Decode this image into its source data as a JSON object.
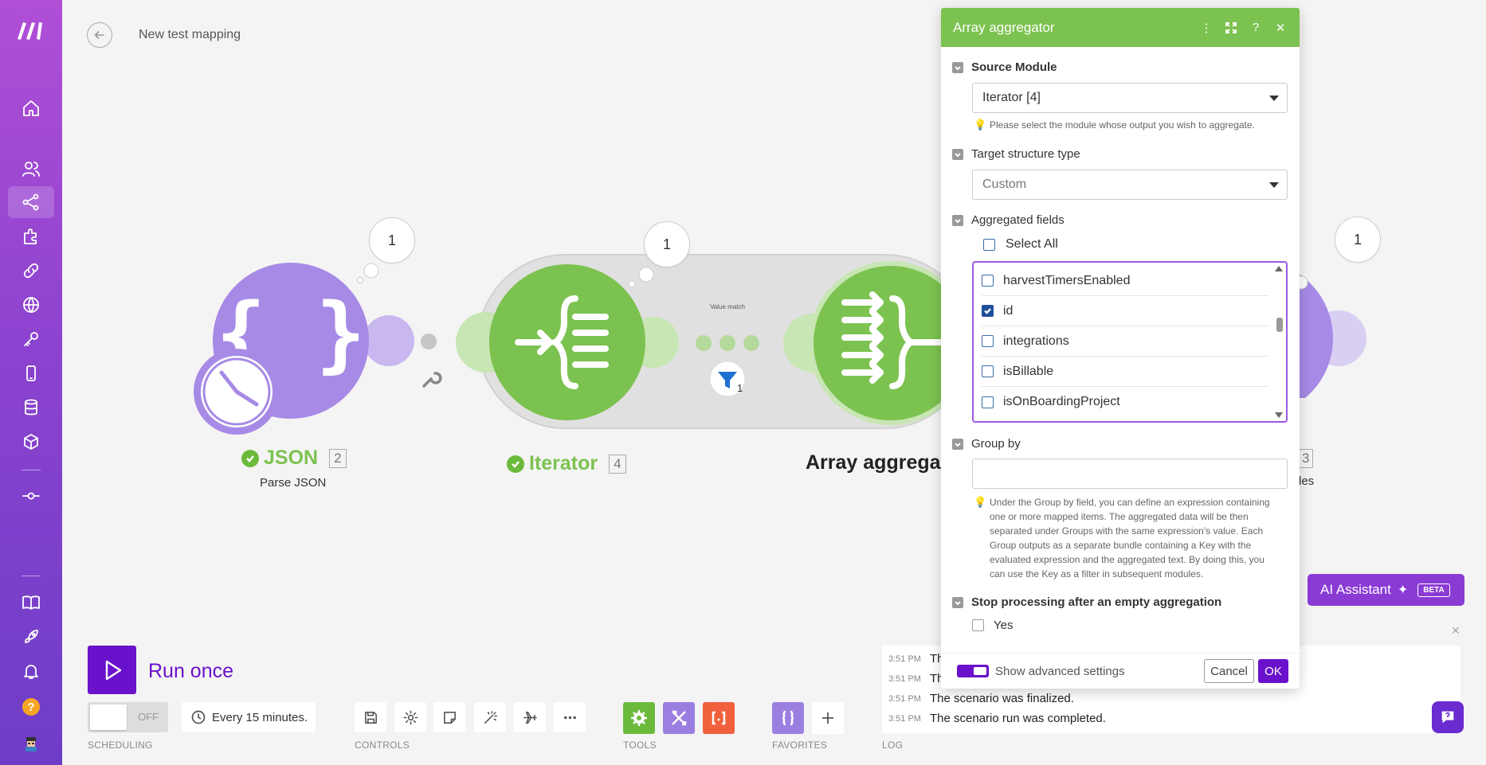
{
  "header": {
    "title": "New test mapping"
  },
  "sidebar": {
    "items": [
      {
        "name": "home"
      },
      {
        "name": "team"
      },
      {
        "name": "scenarios"
      },
      {
        "name": "templates"
      },
      {
        "name": "connections"
      },
      {
        "name": "webhooks"
      },
      {
        "name": "keys"
      },
      {
        "name": "devices"
      },
      {
        "name": "data-stores"
      },
      {
        "name": "data-structures"
      },
      {
        "name": "flow-control"
      },
      {
        "name": "help-docs"
      },
      {
        "name": "whats-new"
      },
      {
        "name": "notifications"
      }
    ]
  },
  "canvas": {
    "modules": [
      {
        "title": "JSON",
        "number": "2",
        "subtitle": "Parse JSON",
        "bubble": "1"
      },
      {
        "title": "Iterator",
        "number": "4",
        "bubble": "1"
      },
      {
        "title": "Array aggrega"
      },
      {
        "number": "3",
        "subtitle": "les",
        "bubble": "1"
      }
    ],
    "filter_label": "Value match",
    "filter_count": "1"
  },
  "panel": {
    "title": "Array aggregator",
    "source_module_label": "Source Module",
    "source_module_value": "Iterator [4]",
    "source_module_hint": "Please select the module whose output you wish to aggregate.",
    "target_type_label": "Target structure type",
    "target_type_value": "Custom",
    "aggregated_fields_label": "Aggregated fields",
    "select_all_label": "Select All",
    "fields": [
      {
        "label": "harvestTimersEnabled",
        "checked": false
      },
      {
        "label": "id",
        "checked": true
      },
      {
        "label": "integrations",
        "checked": false
      },
      {
        "label": "isBillable",
        "checked": false
      },
      {
        "label": "isOnBoardingProject",
        "checked": false
      }
    ],
    "group_by_label": "Group by",
    "group_by_value": "",
    "group_by_hint": "Under the Group by field, you can define an expression containing one or more mapped items. The aggregated data will be then separated under Groups with the same expression's value. Each Group outputs as a separate bundle containing a Key with the evaluated expression and the aggregated text. By doing this, you can use the Key as a filter in subsequent modules.",
    "stop_processing_label": "Stop processing after an empty aggregation",
    "stop_processing_option": "Yes",
    "advanced_label": "Show advanced settings",
    "cancel_label": "Cancel",
    "ok_label": "OK"
  },
  "run": {
    "label": "Run once"
  },
  "scheduling": {
    "toggle_text": "OFF",
    "interval": "Every 15 minutes.",
    "section_label": "SCHEDULING"
  },
  "controls_label": "CONTROLS",
  "tools_label": "TOOLS",
  "favorites_label": "FAVORITES",
  "log_label": "LOG",
  "log": [
    {
      "time": "3:51 PM",
      "text": "Th"
    },
    {
      "time": "3:51 PM",
      "text": "Th"
    },
    {
      "time": "3:51 PM",
      "text": "The scenario was finalized."
    },
    {
      "time": "3:51 PM",
      "text": "The scenario run was completed."
    }
  ],
  "ai_assistant": {
    "label": "AI Assistant",
    "badge": "BETA"
  },
  "colors": {
    "accent": "#6a11cb",
    "module_green": "#7cc250",
    "module_purple": "#a78ae6"
  }
}
